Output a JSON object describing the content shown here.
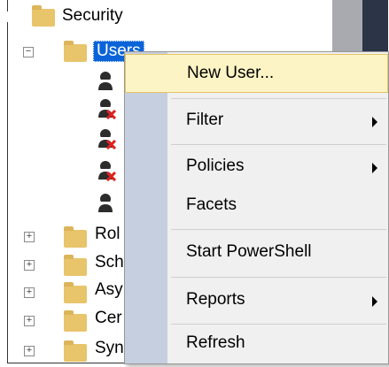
{
  "tree": {
    "security_label": "Security",
    "users_label": "Users",
    "roles_label": "Rol",
    "schemas_label": "Sch",
    "asym_label": "Asy",
    "cert_label": "Cer",
    "sym_label": "Syn",
    "collapse_glyph": "−",
    "expand_glyph": "+"
  },
  "context_menu": {
    "items": [
      {
        "label": "New User..."
      },
      {
        "label": "Filter"
      },
      {
        "label": "Policies"
      },
      {
        "label": "Facets"
      },
      {
        "label": "Start PowerShell"
      },
      {
        "label": "Reports"
      },
      {
        "label": "Refresh"
      }
    ]
  },
  "colors": {
    "highlight_bg": "#fdf4c5",
    "gutter": "#c6cfe0",
    "folder": "#e8c46b",
    "selection": "#0a64d8"
  }
}
